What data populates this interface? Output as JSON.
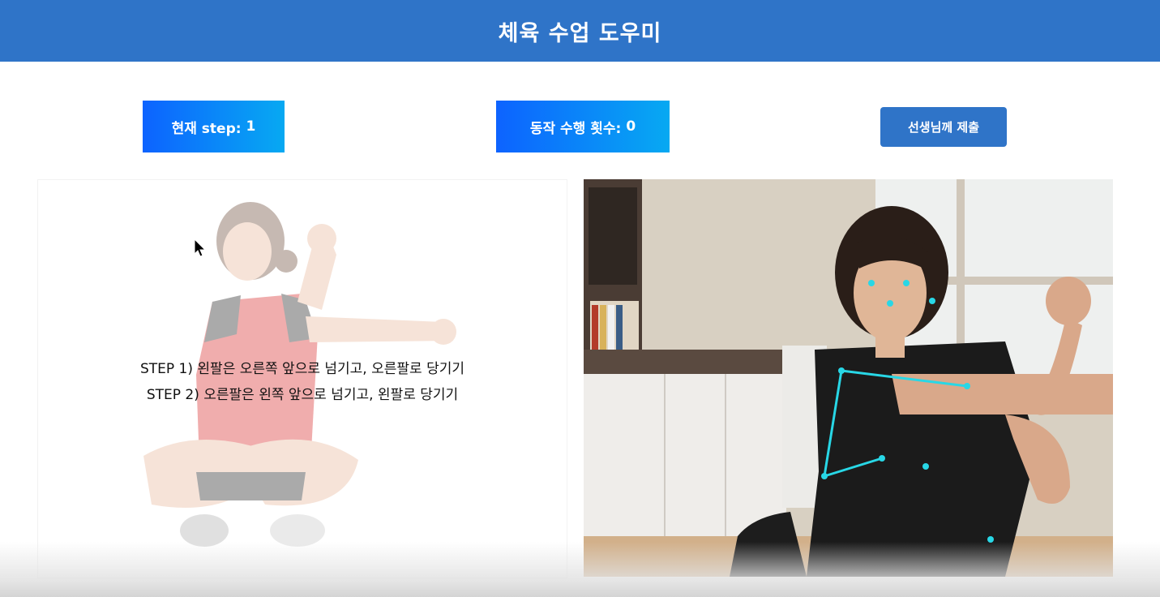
{
  "header": {
    "title": "체육 수업 도우미"
  },
  "status": {
    "step_label": "현재 step:",
    "step_value": "1",
    "count_label": "동작 수행 횟수:",
    "count_value": "0"
  },
  "actions": {
    "submit_label": "선생님께 제출"
  },
  "instructions": {
    "step1": "STEP 1) 왼팔은 오른쪽 앞으로 넘기고, 오른팔로 당기기",
    "step2": "STEP 2) 오른팔은 왼쪽 앞으로 넘기고, 왼팔로 당기기"
  },
  "colors": {
    "header_bg": "#2f74c8",
    "badge_gradient_start": "#0d63ff",
    "badge_gradient_end": "#07a9f2",
    "button_bg": "#2f74c8",
    "skeleton": "#28d7e6"
  }
}
